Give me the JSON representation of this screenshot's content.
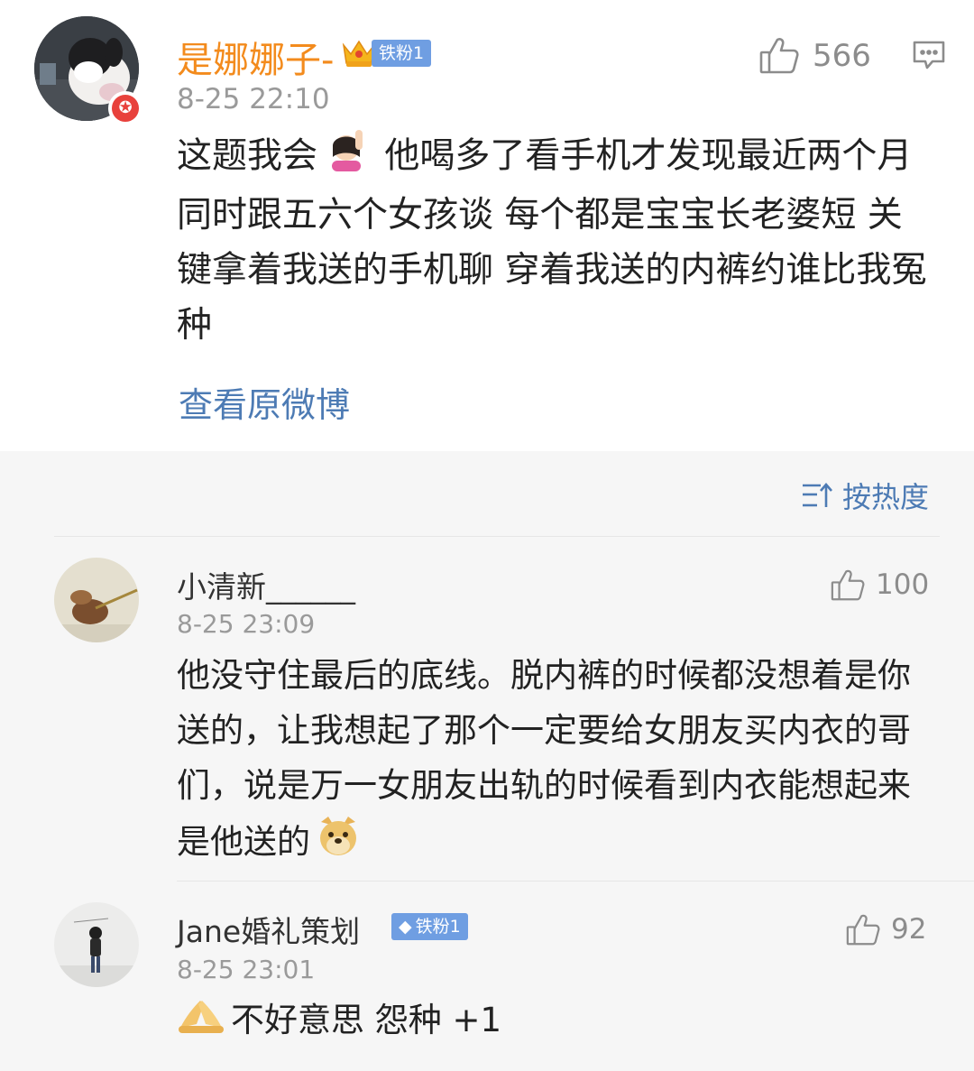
{
  "post": {
    "username": "是娜娜子-",
    "fan_badge": "铁粉1",
    "time": "8-25 22:10",
    "likes": "566",
    "text_before_emoji": "这题我会",
    "text_after_emoji": " 他喝多了看手机才发现最近两个月同时跟五六个女孩谈 每个都是宝宝长老婆短 关键拿着我送的手机聊 穿着我送的内裤约谁比我冤种",
    "view_original": "查看原微博"
  },
  "sort": {
    "label": "按热度"
  },
  "comments": [
    {
      "username": "小清新______",
      "time": "8-25 23:09",
      "likes": "100",
      "text": "他没守住最后的底线。脱内裤的时候都没想着是你送的，让我想起了那个一定要给女朋友买内衣的哥们，说是万一女朋友出轨的时候看到内衣能想起来是他送的"
    },
    {
      "username": "Jane婚礼策划",
      "fan_badge": "铁粉1",
      "time": "8-25 23:01",
      "likes": "92",
      "text": "不好意思 怨种 +1"
    }
  ],
  "colors": {
    "username_vip": "#f38b1d",
    "link": "#4d7bb4",
    "badge": "#6f9ee2",
    "comments_bg": "#f6f6f6"
  },
  "icons": [
    "thumbs-up-icon",
    "comment-icon",
    "crown-icon",
    "verified-icon",
    "sort-icon",
    "doge-emoji-icon",
    "hand-emoji-icon",
    "pray-emoji-icon"
  ]
}
